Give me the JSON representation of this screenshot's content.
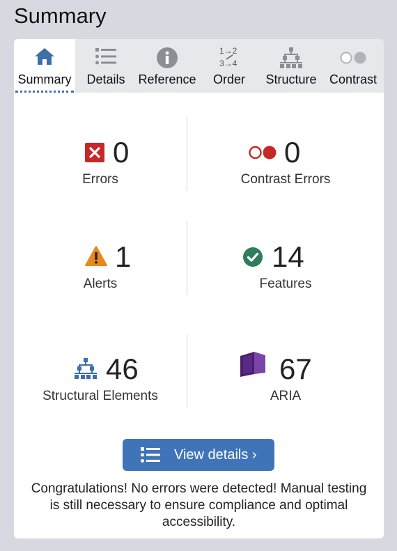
{
  "page": {
    "title": "Summary"
  },
  "tabs": [
    {
      "label": "Summary",
      "icon": "home-icon",
      "active": true
    },
    {
      "label": "Details",
      "icon": "list-icon"
    },
    {
      "label": "Reference",
      "icon": "info-icon"
    },
    {
      "label": "Order",
      "icon": "order-icon",
      "icon_text_top": "1→2",
      "icon_text_bottom": "3→4"
    },
    {
      "label": "Structure",
      "icon": "structure-icon"
    },
    {
      "label": "Contrast",
      "icon": "contrast-icon"
    }
  ],
  "stats": {
    "errors": {
      "value": "0",
      "label": "Errors",
      "icon": "error-icon",
      "color": "#c62828"
    },
    "contrast_errors": {
      "value": "0",
      "label": "Contrast Errors",
      "icon": "contrast-error-icon",
      "color": "#c62828"
    },
    "alerts": {
      "value": "1",
      "label": "Alerts",
      "icon": "alert-icon",
      "color": "#e8891c"
    },
    "features": {
      "value": "14",
      "label": "Features",
      "icon": "feature-check-icon",
      "color": "#2e7d5b"
    },
    "structural": {
      "value": "46",
      "label": "Structural Elements",
      "icon": "structure-icon",
      "color": "#3d6fa8"
    },
    "aria": {
      "value": "67",
      "label": "ARIA",
      "icon": "aria-icon",
      "color": "#5b2a86"
    }
  },
  "view_details": {
    "label": "View details ›",
    "icon": "list-icon"
  },
  "message": "Congratulations! No errors were detected! Manual testing is still necessary to ensure compliance and optimal accessibility."
}
